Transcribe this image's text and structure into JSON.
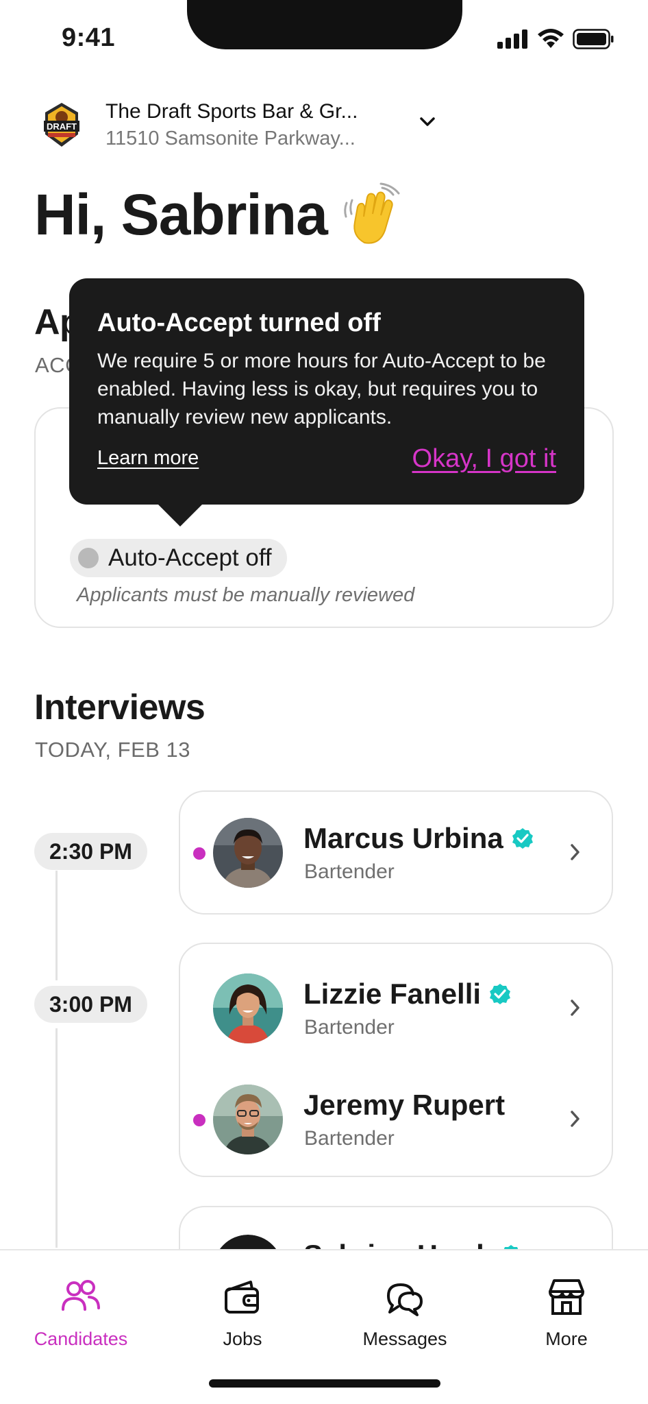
{
  "status_bar": {
    "time": "9:41"
  },
  "business": {
    "name": "The Draft Sports Bar & Gr...",
    "address": "11510 Samsonite Parkway..."
  },
  "greeting": "Hi, Sabrina",
  "applicants_section": {
    "title": "Ap",
    "subtitle": "ACC",
    "auto_accept_label": "Auto-Accept off",
    "auto_accept_desc": "Applicants must be manually reviewed"
  },
  "tooltip": {
    "title": "Auto-Accept turned off",
    "body": "We require 5 or more hours for Auto-Accept to be enabled. Having less is okay, but requires you to manually review new applicants.",
    "learn_more": "Learn more",
    "confirm": "Okay, I got it"
  },
  "interviews": {
    "title": "Interviews",
    "date": "TODAY, FEB 13",
    "slots": [
      {
        "time": "2:30 PM",
        "candidates": [
          {
            "name": "Marcus Urbina",
            "role": "Bartender",
            "verified": true,
            "unread": true
          }
        ]
      },
      {
        "time": "3:00 PM",
        "candidates": [
          {
            "name": "Lizzie Fanelli",
            "role": "Bartender",
            "verified": true,
            "unread": false
          },
          {
            "name": "Jeremy Rupert",
            "role": "Bartender",
            "verified": false,
            "unread": true
          }
        ]
      },
      {
        "candidates": [
          {
            "name": "Sabrina Hawk",
            "verified": true
          }
        ]
      }
    ]
  },
  "nav": {
    "items": [
      {
        "label": "Candidates",
        "icon": "people-icon",
        "active": true
      },
      {
        "label": "Jobs",
        "icon": "wallet-icon",
        "active": false
      },
      {
        "label": "Messages",
        "icon": "chat-bubbles-icon",
        "active": false
      },
      {
        "label": "More",
        "icon": "storefront-icon",
        "active": false
      }
    ]
  },
  "colors": {
    "accent": "#c92fbf",
    "verified": "#18c9c3",
    "tooltip_bg": "#1b1b1b"
  }
}
